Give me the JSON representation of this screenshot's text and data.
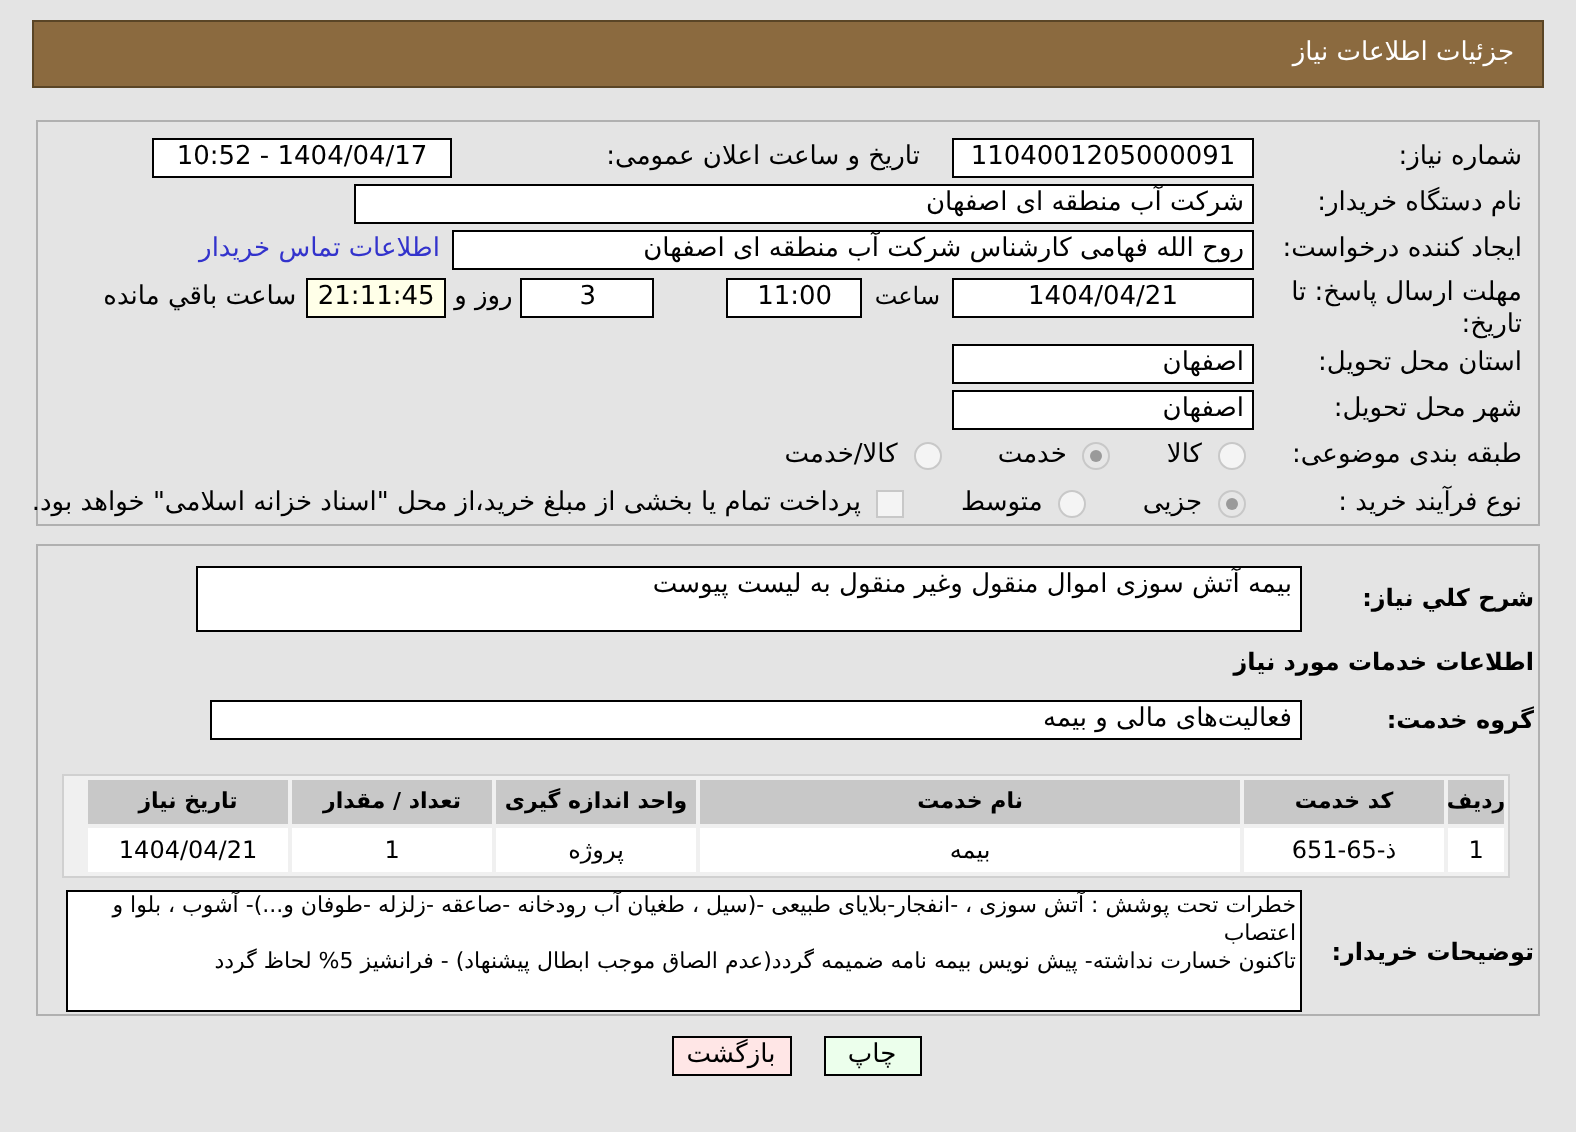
{
  "title": "جزئیات اطلاعات نیاز",
  "need_number": {
    "label": "شماره نیاز:",
    "value": "1104001205000091"
  },
  "announce": {
    "label": "تاریخ و ساعت اعلان عمومی:",
    "value": "1404/04/17 - 10:52"
  },
  "buyer": {
    "label": "نام دستگاه خریدار:",
    "value": "شرکت آب منطقه ای اصفهان"
  },
  "creator": {
    "label": "ایجاد کننده درخواست:",
    "value": "روح الله فهامی کارشناس شرکت آب منطقه ای اصفهان",
    "link": "اطلاعات تماس خریدار"
  },
  "deadline": {
    "label": "مهلت ارسال پاسخ: تا تاریخ:",
    "date": "1404/04/21",
    "time_label": "ساعت",
    "time": "11:00",
    "days": "3",
    "days_label": "روز و",
    "remaining": "21:11:45",
    "remaining_label": "ساعت باقي مانده"
  },
  "province": {
    "label": "استان محل تحویل:",
    "value": "اصفهان"
  },
  "city": {
    "label": "شهر محل تحویل:",
    "value": "اصفهان"
  },
  "category": {
    "label": "طبقه بندی موضوعی:",
    "options": [
      {
        "label": "کالا",
        "selected": false
      },
      {
        "label": "خدمت",
        "selected": true
      },
      {
        "label": "کالا/خدمت",
        "selected": false
      }
    ]
  },
  "purchase_type": {
    "label": "نوع فرآیند خرید :",
    "options": [
      {
        "label": "جزیی",
        "selected": true
      },
      {
        "label": "متوسط",
        "selected": false
      }
    ],
    "payment": {
      "checked": false,
      "text": "پرداخت تمام یا بخشی از مبلغ خرید،از محل \"اسناد خزانه اسلامی\" خواهد بود."
    }
  },
  "summary": {
    "label": "شرح کلي نیاز:",
    "value": "بیمه آتش سوزی اموال منقول وغیر منقول به لیست پیوست"
  },
  "services_heading": "اطلاعات خدمات مورد نیاز",
  "service_group": {
    "label": "گروه خدمت:",
    "value": "فعالیت‌های مالی و بیمه"
  },
  "table": {
    "columns": [
      "ردیف",
      "کد خدمت",
      "نام خدمت",
      "واحد اندازه گیری",
      "تعداد / مقدار",
      "تاریخ نیاز"
    ],
    "rows": [
      [
        "1",
        "ذ-65-651",
        "بیمه",
        "پروژه",
        "1",
        "1404/04/21"
      ]
    ]
  },
  "buyer_notes": {
    "label": "توضیحات خریدار:",
    "value": "خطرات تحت پوشش : آتش سوزی ، -انفجار-بلایای طبیعی -(سیل ، طغیان آب رودخانه -صاعقه -زلزله -طوفان و...)- آشوب ، بلوا و اعتصاب\nتاکنون خسارت نداشته- پیش نویس بیمه نامه ضمیمه گردد(عدم الصاق موجب ابطال پیشنهاد) - فرانشیز 5% لحاظ گردد"
  },
  "buttons": [
    {
      "label": "چاپ",
      "kind": "print"
    },
    {
      "label": "بازگشت",
      "kind": "back"
    }
  ]
}
